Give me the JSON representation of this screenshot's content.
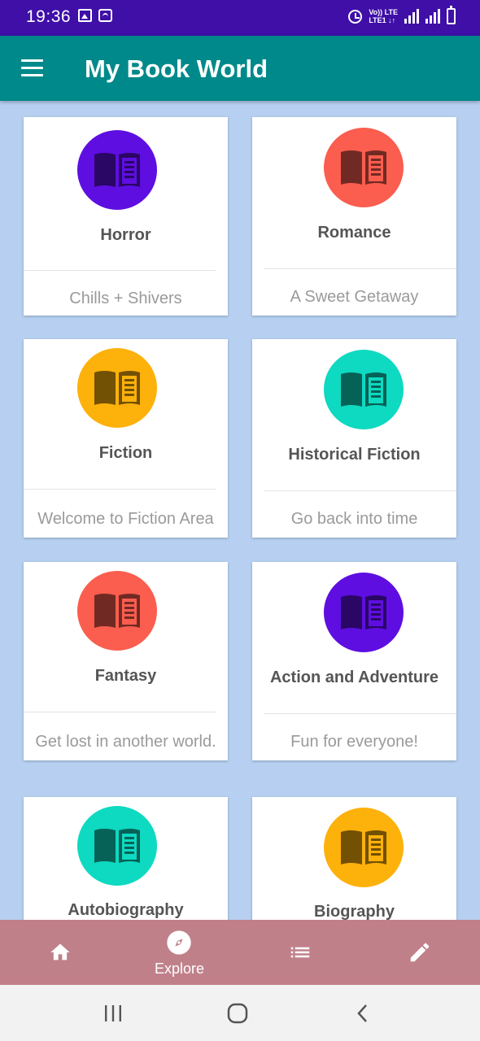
{
  "status_bar": {
    "time": "19:36",
    "network_top": "Vo)) LTE",
    "network_bottom": "LTE1 ↓↑"
  },
  "app_bar": {
    "title": "My Book World",
    "menu_icon": "hamburger-menu-icon"
  },
  "categories": [
    {
      "title": "Horror",
      "subtitle": "Chills + Shivers",
      "color": "#5e0ee0",
      "icon": "book-icon"
    },
    {
      "title": "Romance",
      "subtitle": "A Sweet Getaway",
      "color": "#fb5d4f",
      "icon": "book-icon"
    },
    {
      "title": "Fiction",
      "subtitle": "Welcome to Fiction Area",
      "color": "#fdb10b",
      "icon": "book-icon"
    },
    {
      "title": "Historical Fiction",
      "subtitle": "Go back into time",
      "color": "#0ed9c1",
      "icon": "book-icon"
    },
    {
      "title": "Fantasy",
      "subtitle": "Get lost in another world.",
      "color": "#fb5d4f",
      "icon": "book-icon"
    },
    {
      "title": "Action and Adventure",
      "subtitle": "Fun for everyone!",
      "color": "#5e0ee0",
      "icon": "book-icon"
    },
    {
      "title": "Autobiography",
      "subtitle": "",
      "color": "#0ed9c1",
      "icon": "book-icon"
    },
    {
      "title": "Biography",
      "subtitle": "",
      "color": "#fdb10b",
      "icon": "book-icon"
    }
  ],
  "bottom_nav": {
    "items": [
      {
        "icon": "home-icon",
        "label": ""
      },
      {
        "icon": "compass-icon",
        "label": "Explore"
      },
      {
        "icon": "list-icon",
        "label": ""
      },
      {
        "icon": "pencil-icon",
        "label": ""
      }
    ],
    "active_index": 1
  },
  "system_nav": {
    "items": [
      {
        "icon": "recents-icon"
      },
      {
        "icon": "home-circle-icon"
      },
      {
        "icon": "back-icon"
      }
    ]
  },
  "colors": {
    "status_bar": "#3f0fa8",
    "app_bar": "#00898a",
    "background": "#b7d0f1",
    "bottom_nav": "#c0808a"
  }
}
